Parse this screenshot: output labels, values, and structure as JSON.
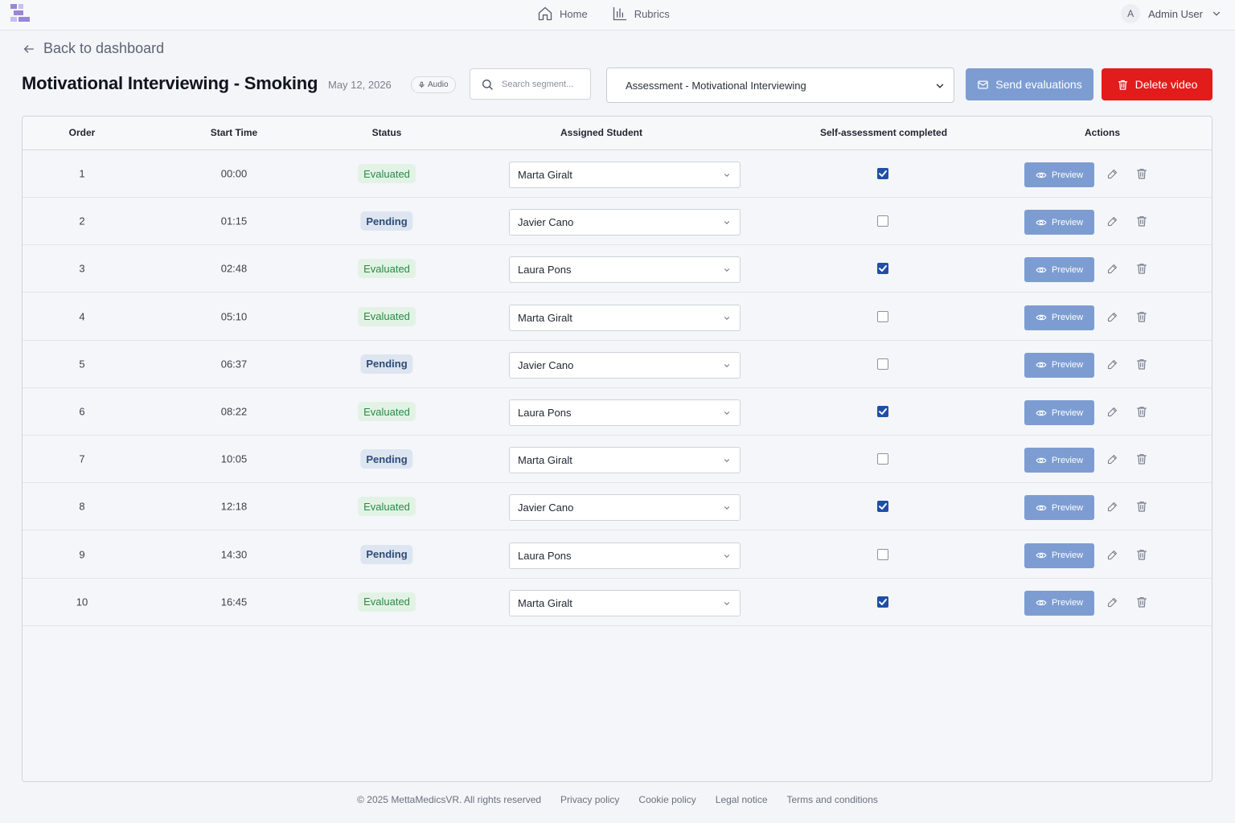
{
  "nav": {
    "home_label": "Home",
    "rubrics_label": "Rubrics",
    "user_initial": "A",
    "user_name": "Admin User"
  },
  "back_label": "Back to dashboard",
  "header": {
    "title": "Motivational Interviewing - Smoking",
    "date": "May 12, 2026",
    "media_type": "Audio",
    "search_placeholder": "Search segment...",
    "rubric_selected": "Assessment - Motivational Interviewing",
    "send_label": "Send evaluations",
    "delete_label": "Delete video"
  },
  "table": {
    "columns": [
      "Order",
      "Start Time",
      "Status",
      "Assigned Student",
      "Self-assessment completed",
      "Actions"
    ],
    "preview_label": "Preview",
    "rows": [
      {
        "order": "1",
        "start": "00:00",
        "status": "Evaluated",
        "student": "Marta Giralt",
        "self_done": true
      },
      {
        "order": "2",
        "start": "01:15",
        "status": "Pending",
        "student": "Javier Cano",
        "self_done": false
      },
      {
        "order": "3",
        "start": "02:48",
        "status": "Evaluated",
        "student": "Laura Pons",
        "self_done": true
      },
      {
        "order": "4",
        "start": "05:10",
        "status": "Evaluated",
        "student": "Marta Giralt",
        "self_done": false
      },
      {
        "order": "5",
        "start": "06:37",
        "status": "Pending",
        "student": "Javier Cano",
        "self_done": false
      },
      {
        "order": "6",
        "start": "08:22",
        "status": "Evaluated",
        "student": "Laura Pons",
        "self_done": true
      },
      {
        "order": "7",
        "start": "10:05",
        "status": "Pending",
        "student": "Marta Giralt",
        "self_done": false
      },
      {
        "order": "8",
        "start": "12:18",
        "status": "Evaluated",
        "student": "Javier Cano",
        "self_done": true
      },
      {
        "order": "9",
        "start": "14:30",
        "status": "Pending",
        "student": "Laura Pons",
        "self_done": false
      },
      {
        "order": "10",
        "start": "16:45",
        "status": "Evaluated",
        "student": "Marta Giralt",
        "self_done": true
      }
    ]
  },
  "footer": {
    "copyright": "© 2025 MettaMedicsVR. All rights reserved",
    "links": [
      "Privacy policy",
      "Cookie policy",
      "Legal notice",
      "Terms and conditions"
    ]
  },
  "colors": {
    "primary_button": "#7d9dd2",
    "danger_button": "#e21b1b",
    "evaluated_badge": "#e2f3e6",
    "pending_badge": "#dde5f1",
    "checkbox_checked": "#1f4fa8"
  },
  "icons": {
    "logo": "app-logo-icon",
    "home": "home-icon",
    "rubrics": "bar-chart-icon",
    "back": "arrow-left-icon",
    "search": "search-icon",
    "send": "mail-icon",
    "delete": "trash-icon",
    "preview": "eye-icon",
    "edit": "pencil-icon"
  }
}
